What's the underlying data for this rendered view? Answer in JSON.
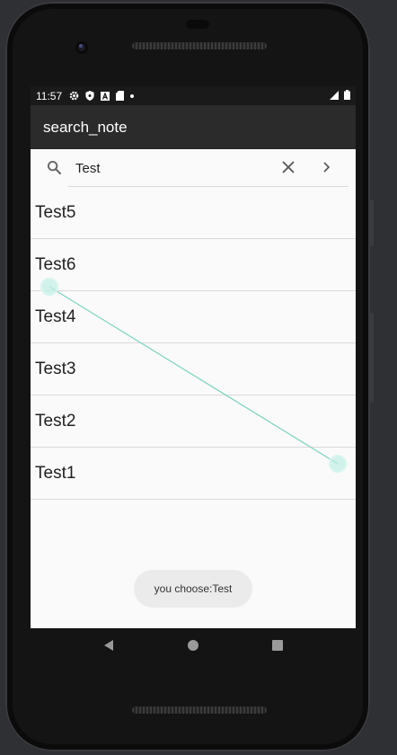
{
  "status_bar": {
    "time": "11:57",
    "icons": [
      "settings-icon",
      "shield-icon",
      "font-a-icon",
      "sd-card-icon",
      "dot-icon"
    ],
    "right_icons": [
      "signal-icon",
      "battery-icon"
    ]
  },
  "app_bar": {
    "title": "search_note"
  },
  "search": {
    "value": "Test",
    "icons": {
      "search": "search-icon",
      "clear": "close-icon",
      "submit": "chevron-right-icon"
    }
  },
  "results": [
    {
      "label": "Test5"
    },
    {
      "label": "Test6"
    },
    {
      "label": "Test4"
    },
    {
      "label": "Test3"
    },
    {
      "label": "Test2"
    },
    {
      "label": "Test1"
    }
  ],
  "toast": {
    "message": "you choose:Test"
  },
  "nav": {
    "back": "back-triangle-icon",
    "home": "home-circle-icon",
    "recents": "recents-square-icon"
  },
  "colors": {
    "app_bar": "#2b2b2b",
    "status_bar": "#1a1a1a",
    "screen_bg": "#fafafa",
    "gesture_trace": "#7dd3c0"
  }
}
